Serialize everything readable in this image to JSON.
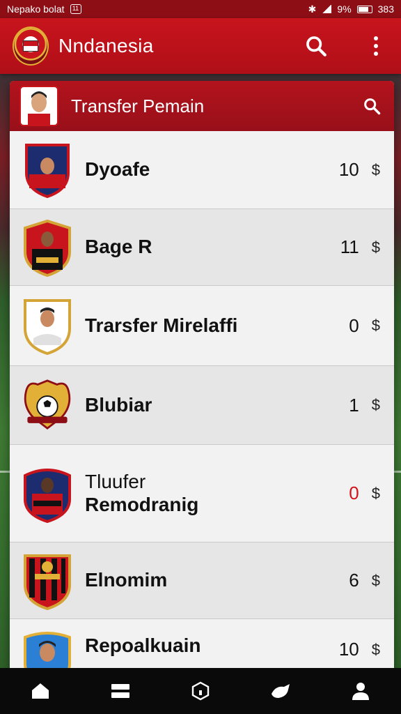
{
  "status_bar": {
    "carrier": "Nepako bolat",
    "badge": "11",
    "battery_text": "9%",
    "time": "383"
  },
  "app_bar": {
    "title": "Nndanesia",
    "icons": [
      "crest-logo",
      "search-icon",
      "more-vert-icon"
    ]
  },
  "panel": {
    "title": "Transfer Pemain",
    "icons": [
      "player-avatar",
      "search-icon"
    ]
  },
  "players": [
    {
      "name": "Dyoafe",
      "count": "10",
      "currency": "$",
      "badge_colors": [
        "#1c2c6e",
        "#c8141d"
      ]
    },
    {
      "name": "Bage R",
      "count": "11",
      "currency": "$",
      "badge_colors": [
        "#c8141d",
        "#111111"
      ]
    },
    {
      "name": "Trarsfer Mirelaffi",
      "count": "0",
      "currency": "$",
      "badge_colors": [
        "#ffffff",
        "#d4a437"
      ]
    },
    {
      "name": "Blubiar",
      "count": "1",
      "currency": "$",
      "badge_colors": [
        "#e3b037",
        "#8e0e16"
      ]
    },
    {
      "sub": "Tluufer",
      "name": "Remodranig",
      "count": "0",
      "currency": "$",
      "accent": true,
      "badge_colors": [
        "#1c2c6e",
        "#c8141d"
      ]
    },
    {
      "name": "Elnomim",
      "count": "6",
      "currency": "$",
      "badge_colors": [
        "#c8141d",
        "#d4a437"
      ]
    },
    {
      "name": "Repoalkuain",
      "count": "10",
      "currency": "$",
      "badge_colors": [
        "#2b7fd4",
        "#e3b037"
      ]
    }
  ],
  "colors": {
    "primary": "#c8141d",
    "status_bar": "#8e0e16",
    "accent_count": "#d3121b"
  },
  "bottom_nav": [
    "home-icon",
    "list-icon",
    "shield-icon",
    "transfer-icon",
    "profile-icon"
  ]
}
